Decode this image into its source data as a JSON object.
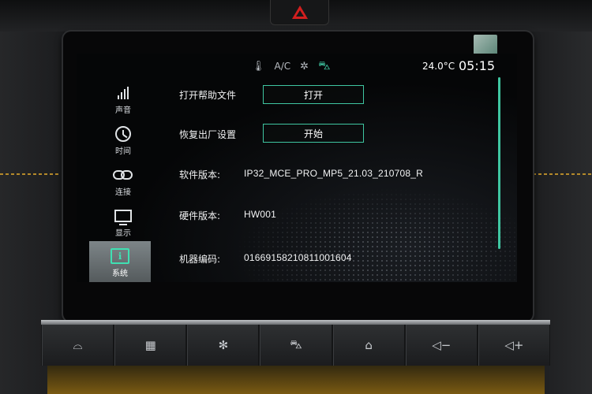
{
  "status_bar": {
    "ac_label": "A/C",
    "temperature": "24.0°C",
    "time": "05:15",
    "icons": [
      "thermometer-icon",
      "fan-auto-icon",
      "car-status-icon"
    ],
    "accent_color": "#3fc6a1"
  },
  "sidebar": {
    "items": [
      {
        "id": "sound",
        "label": "声音",
        "icon": "volume-bars-icon",
        "active": false
      },
      {
        "id": "time",
        "label": "时间",
        "icon": "clock-icon",
        "active": false
      },
      {
        "id": "connect",
        "label": "连接",
        "icon": "link-icon",
        "active": false
      },
      {
        "id": "display",
        "label": "显示",
        "icon": "monitor-icon",
        "active": false
      },
      {
        "id": "system",
        "label": "系统",
        "icon": "system-info-icon",
        "active": true
      }
    ]
  },
  "content": {
    "help_file": {
      "label": "打开帮助文件",
      "button": "打开"
    },
    "factory_reset": {
      "label": "恢复出厂设置",
      "button": "开始"
    },
    "software_version": {
      "label": "软件版本:",
      "value": "IP32_MCE_PRO_MP5_21.03_210708_R"
    },
    "hardware_version": {
      "label": "硬件版本:",
      "value": "HW001"
    },
    "machine_code": {
      "label": "机器编码:",
      "value": "01669158210811001604"
    }
  },
  "hardware_buttons": [
    {
      "id": "defrost-front",
      "icon": "front-defrost-icon",
      "glyph": "⌓"
    },
    {
      "id": "defrost-rear",
      "icon": "rear-defrost-icon",
      "glyph": "▦"
    },
    {
      "id": "climate",
      "icon": "fan-climate-icon",
      "glyph": "✻"
    },
    {
      "id": "vehicle",
      "icon": "car-icon",
      "glyph": "⛍"
    },
    {
      "id": "home",
      "icon": "home-icon",
      "glyph": "⌂"
    },
    {
      "id": "vol-down",
      "icon": "volume-down-icon",
      "glyph": "◁−"
    },
    {
      "id": "vol-up",
      "icon": "volume-up-icon",
      "glyph": "◁+"
    }
  ],
  "dash": {
    "hazard_color": "#d21f1f"
  }
}
